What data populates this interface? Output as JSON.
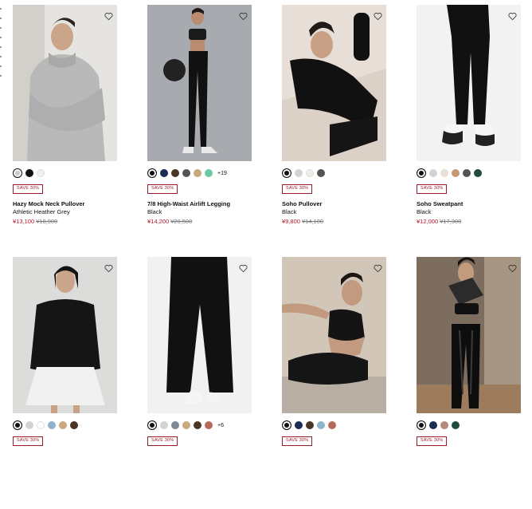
{
  "products": [
    {
      "name": "Hazy Mock Neck Pullover",
      "color": "Athletic Heather Grey",
      "sale_price": "¥13,100",
      "orig_price": "¥18,900",
      "badge": "SAVE 30%",
      "image_bg": "#d9d9d9",
      "swatches": [
        "#c9c9c9",
        "#111111",
        "#f3eee9"
      ],
      "more": ""
    },
    {
      "name": "7/8 High-Waist Airlift Legging",
      "color": "Black",
      "sale_price": "¥14,200",
      "orig_price": "¥20,500",
      "badge": "SAVE 30%",
      "image_bg": "#9ea2a6",
      "swatches": [
        "#111111",
        "#1b2d55",
        "#4a3527",
        "#555555",
        "#c9a77f",
        "#6fc8a4"
      ],
      "more": "+19"
    },
    {
      "name": "Soho Pullover",
      "color": "Black",
      "sale_price": "¥9,800",
      "orig_price": "¥14,100",
      "badge": "SAVE 30%",
      "image_bg": "#e6ded6",
      "swatches": [
        "#111111",
        "#d3d3d3",
        "#f1ece6",
        "#555555"
      ],
      "more": ""
    },
    {
      "name": "Soho Sweatpant",
      "color": "Black",
      "sale_price": "¥12,000",
      "orig_price": "¥17,300",
      "badge": "SAVE 30%",
      "image_bg": "#f0f0f0",
      "swatches": [
        "#111111",
        "#d3d3d3",
        "#e8e0d6",
        "#c59a73",
        "#555555",
        "#1f4a3e"
      ],
      "more": ""
    },
    {
      "name": "",
      "color": "",
      "sale_price": "",
      "orig_price": "",
      "badge": "SAVE 30%",
      "image_bg": "#d8d8d6",
      "swatches": [
        "#111111",
        "#d3d3d3",
        "#ffffff",
        "#8fb3cc",
        "#c9a77f",
        "#4a3527"
      ],
      "more": ""
    },
    {
      "name": "",
      "color": "",
      "sale_price": "",
      "orig_price": "",
      "badge": "SAVE 30%",
      "image_bg": "#eeeeee",
      "swatches": [
        "#111111",
        "#d3d3d3",
        "#7d8a96",
        "#c9a77f",
        "#4a3527",
        "#b56b5a"
      ],
      "more": "+6"
    },
    {
      "name": "",
      "color": "",
      "sale_price": "",
      "orig_price": "",
      "badge": "SAVE 30%",
      "image_bg": "#cfc2b4",
      "swatches": [
        "#111111",
        "#1b2d55",
        "#4a3527",
        "#8fb3cc",
        "#b56b5a"
      ],
      "more": ""
    },
    {
      "name": "",
      "color": "",
      "sale_price": "",
      "orig_price": "",
      "badge": "SAVE 30%",
      "image_bg": "#6f6155",
      "swatches": [
        "#111111",
        "#1b2d55",
        "#b58a7a",
        "#1f4a3e"
      ],
      "more": ""
    }
  ]
}
